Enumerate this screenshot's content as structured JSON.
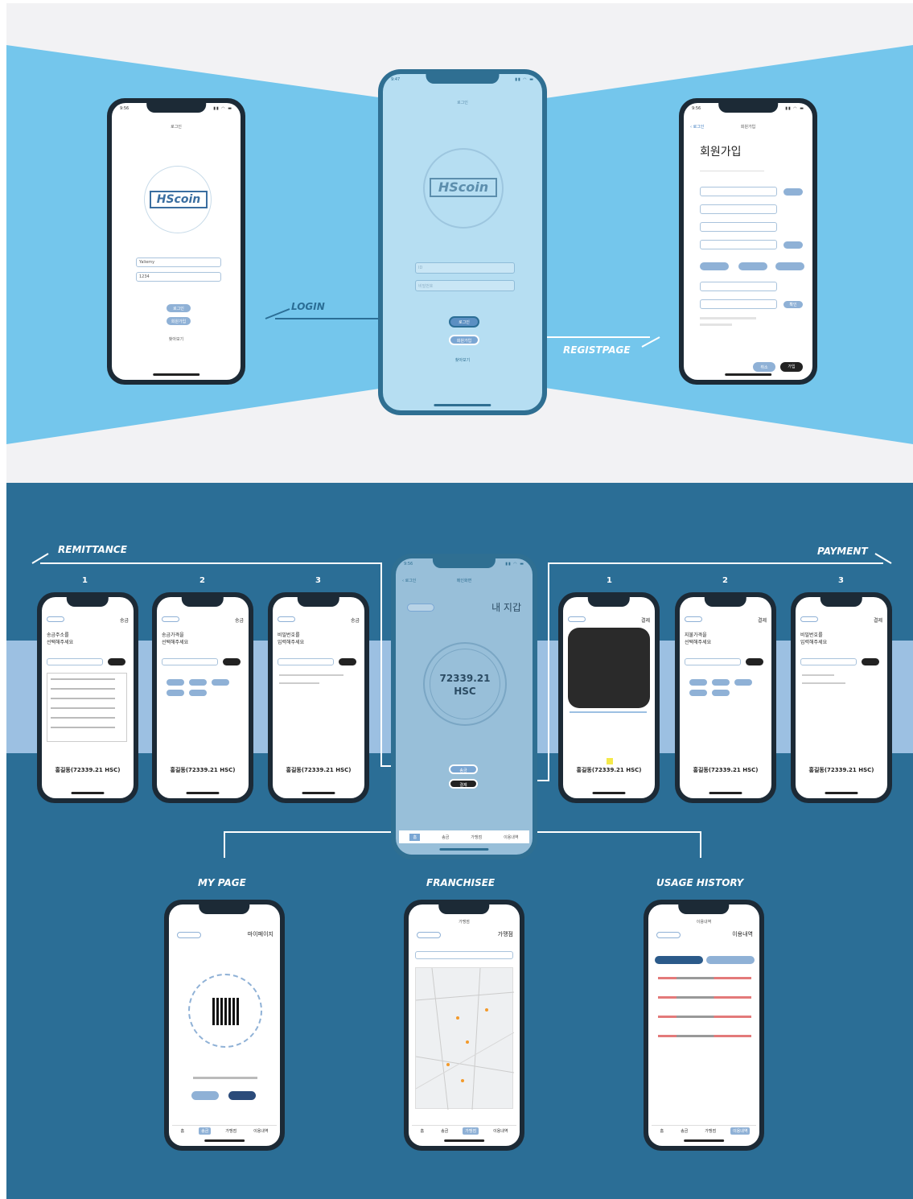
{
  "top_section": {
    "labels": {
      "login": "LOGIN",
      "registpage": "REGISTPAGE"
    },
    "login_screen": {
      "time": "9:56",
      "title": "로그인",
      "logo": "HScoin",
      "id_value": "Yaliemy",
      "pw_value": "1234",
      "login_button": "로그인",
      "signup_button": "회원가입",
      "find_link": "찾아보기"
    },
    "center_screen": {
      "time": "9:47",
      "title": "로그인",
      "logo": "HScoin",
      "id_placeholder": "ID",
      "pw_placeholder": "비밀번호",
      "login_button": "로그인",
      "signup_button": "회원가입",
      "find_link": "찾아보기"
    },
    "register_screen": {
      "time": "9:56",
      "back": "로그인",
      "nav_title": "회원가입",
      "heading": "회원가입",
      "check_button": "확인",
      "cancel_button": "취소",
      "join_button": "가입"
    }
  },
  "bottom_section": {
    "labels": {
      "remittance": "REMITTANCE",
      "payment": "PAYMENT",
      "my_page": "MY PAGE",
      "franchisee": "FRANCHISEE",
      "usage_history": "USAGE HISTORY"
    },
    "step_numbers": [
      "1",
      "2",
      "3"
    ],
    "remittance_screens": [
      {
        "mode": "송금",
        "prompt_line1": "송금주소를",
        "prompt_line2": "선택해주세요",
        "balance": "홍길동(72339.21 HSC)"
      },
      {
        "mode": "송금",
        "prompt_line1": "송금가격을",
        "prompt_line2": "선택해주세요",
        "balance": "홍길동(72339.21 HSC)"
      },
      {
        "mode": "송금",
        "prompt_line1": "비밀번호를",
        "prompt_line2": "입력해주세요",
        "balance": "홍길동(72339.21 HSC)"
      }
    ],
    "payment_screens": [
      {
        "mode": "결제",
        "balance": "홍길동(72339.21 HSC)"
      },
      {
        "mode": "결제",
        "prompt_line1": "지불가격을",
        "prompt_line2": "선택해주세요",
        "balance": "홍길동(72339.21 HSC)"
      },
      {
        "mode": "결제",
        "prompt_line1": "비밀번호를",
        "prompt_line2": "입력해주세요",
        "balance": "홍길동(72339.21 HSC)"
      }
    ],
    "wallet_screen": {
      "time": "9:56",
      "back": "로그인",
      "nav_title": "메인화면",
      "title": "내 지갑",
      "balance_value": "72339.21",
      "balance_unit": "HSC",
      "send_button": "송금",
      "pay_button": "결제",
      "tabs": [
        "홈",
        "송금",
        "가맹점",
        "이용내역"
      ]
    },
    "mypage_screen": {
      "title": "마이페이지",
      "tabs": [
        "홈",
        "송금",
        "가맹점",
        "이용내역"
      ]
    },
    "franchisee_screen": {
      "nav_title": "가맹점",
      "title": "가맹점",
      "tabs": [
        "홈",
        "송금",
        "가맹점",
        "이용내역"
      ]
    },
    "history_screen": {
      "nav_title": "이용내역",
      "title": "이용내역",
      "tabs": [
        "홈",
        "송금",
        "가맹점",
        "이용내역"
      ]
    }
  },
  "colors": {
    "light_blue": "#74c6ec",
    "dark_blue": "#2b6e96",
    "pill_blue": "#8fb1d6"
  }
}
